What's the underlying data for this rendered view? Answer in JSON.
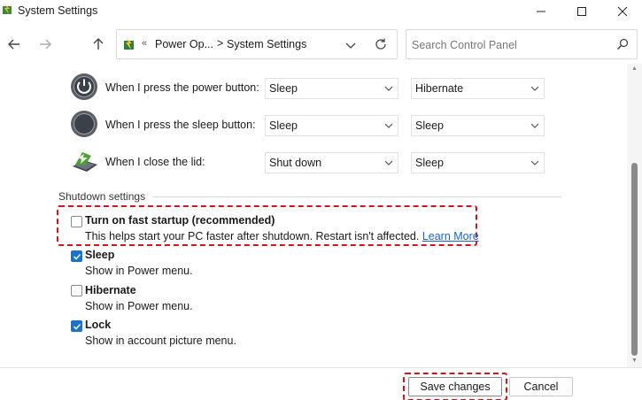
{
  "window": {
    "title": "System Settings",
    "controls": {
      "minimize": "–",
      "maximize": "□",
      "close": "✕"
    }
  },
  "address": {
    "sep1": "«",
    "crumb1": "Power Op...",
    "sep2": ">",
    "crumb2": "System Settings"
  },
  "search": {
    "placeholder": "Search Control Panel"
  },
  "buttons_section": {
    "rows": [
      {
        "label": "When I press the power button:",
        "option1": "Sleep",
        "option2": "Hibernate",
        "icon": "power-button-icon"
      },
      {
        "label": "When I press the sleep button:",
        "option1": "Sleep",
        "option2": "Sleep",
        "icon": "sleep-button-icon"
      },
      {
        "label": "When I close the lid:",
        "option1": "Shut down",
        "option2": "Sleep",
        "icon": "laptop-lid-icon"
      }
    ]
  },
  "shutdown": {
    "title": "Shutdown settings",
    "items": [
      {
        "label": "Turn on fast startup (recommended)",
        "desc": "This helps start your PC faster after shutdown. Restart isn't affected.",
        "link": "Learn More",
        "checked": false
      },
      {
        "label": "Sleep",
        "desc": "Show in Power menu.",
        "checked": true
      },
      {
        "label": "Hibernate",
        "desc": "Show in Power menu.",
        "checked": false
      },
      {
        "label": "Lock",
        "desc": "Show in account picture menu.",
        "checked": true
      }
    ]
  },
  "footer": {
    "save": "Save changes",
    "cancel": "Cancel"
  },
  "colors": {
    "accent": "#1a73c8",
    "highlight": "#d4141c",
    "link": "#1a62c7"
  }
}
